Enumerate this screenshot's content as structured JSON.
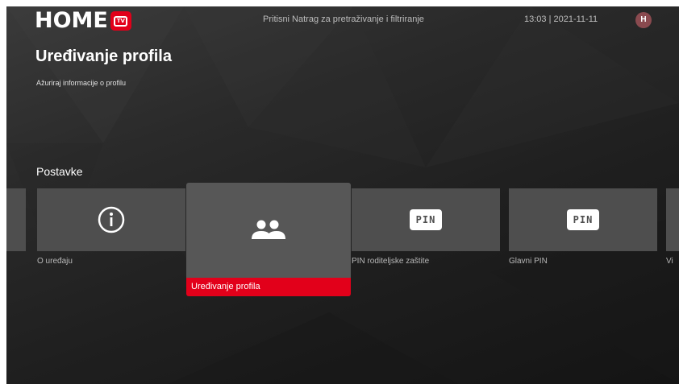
{
  "header": {
    "logo_text": "HOME",
    "logo_badge_text": "TV",
    "hint": "Pritisni Natrag za pretraživanje i filtriranje",
    "datetime": "13:03 | 2021-11-11",
    "avatar_initial": "H"
  },
  "page": {
    "title": "Uređivanje profila",
    "subtitle": "Ažuriraj informacije o profilu",
    "section": "Postavke"
  },
  "cards": [
    {
      "label": "",
      "icon": "partial-card"
    },
    {
      "label": "O uređaju",
      "icon": "info-icon"
    },
    {
      "label": "Uređivanje profila",
      "icon": "users-icon",
      "focused": true
    },
    {
      "label": "PIN roditeljske zaštite",
      "icon": "pin-icon",
      "badge": "PIN"
    },
    {
      "label": "Glavni PIN",
      "icon": "pin-icon",
      "badge": "PIN"
    },
    {
      "label": "Vi",
      "icon": "partial-card"
    }
  ],
  "colors": {
    "accent": "#e2001a",
    "tile": "#4e4e4e",
    "tile_focused": "#575757",
    "avatar": "#8a4a4f"
  }
}
